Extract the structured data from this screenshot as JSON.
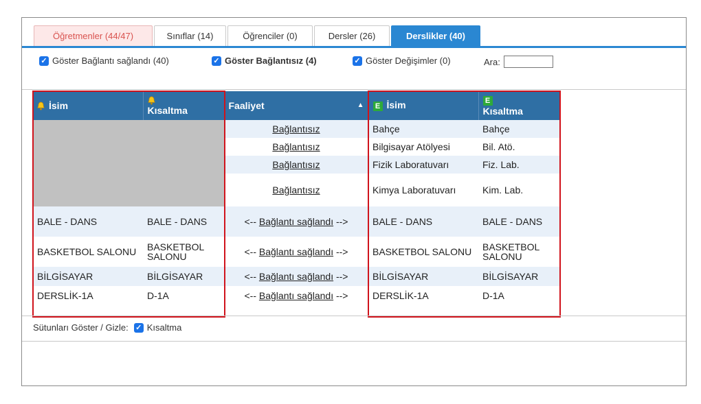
{
  "tabs": [
    {
      "label": "Öğretmenler (44/47)",
      "state": "warning"
    },
    {
      "label": "Sınıflar (14)",
      "state": "normal"
    },
    {
      "label": "Öğrenciler (0)",
      "state": "normal"
    },
    {
      "label": "Dersler (26)",
      "state": "normal"
    },
    {
      "label": "Derslikler (40)",
      "state": "active"
    }
  ],
  "filters": {
    "connected_label": "Göster Bağlantı sağlandı (40)",
    "unconnected_label": "Göster Bağlantısız (4)",
    "changes_label": "Göster Değişimler (0)",
    "search_label": "Ara:",
    "search_value": ""
  },
  "table": {
    "headers": {
      "left_name": "İsim",
      "left_abbr": "Kısaltma",
      "activity": "Faaliyet",
      "right_name": "İsim",
      "right_abbr": "Kısaltma"
    },
    "sort_indicator": "▲",
    "rows": [
      {
        "left_name": "",
        "left_abbr": "",
        "activity": "Bağlantısız",
        "right_name": "Bahçe",
        "right_abbr": "Bahçe"
      },
      {
        "left_name": "",
        "left_abbr": "",
        "activity": "Bağlantısız",
        "right_name": "Bilgisayar Atölyesi",
        "right_abbr": "Bil. Atö."
      },
      {
        "left_name": "",
        "left_abbr": "",
        "activity": "Bağlantısız",
        "right_name": "Fizik Laboratuvarı",
        "right_abbr": "Fiz. Lab."
      },
      {
        "left_name": "",
        "left_abbr": "",
        "activity": "Bağlantısız",
        "right_name": "Kimya Laboratuvarı",
        "right_abbr": "Kim. Lab."
      },
      {
        "left_name": "BALE - DANS",
        "left_abbr": "BALE - DANS",
        "activity_prefix": "<-- ",
        "activity": "Bağlantı sağlandı",
        "activity_suffix": " -->",
        "right_name": "BALE - DANS",
        "right_abbr": "BALE - DANS"
      },
      {
        "left_name": "BASKETBOL SALONU",
        "left_abbr": "BASKETBOL SALONU",
        "activity_prefix": "<-- ",
        "activity": "Bağlantı sağlandı",
        "activity_suffix": " -->",
        "right_name": "BASKETBOL SALONU",
        "right_abbr": "BASKETBOL SALONU"
      },
      {
        "left_name": "BİLGİSAYAR",
        "left_abbr": "BİLGİSAYAR",
        "activity_prefix": "<-- ",
        "activity": "Bağlantı sağlandı",
        "activity_suffix": " -->",
        "right_name": "BİLGİSAYAR",
        "right_abbr": "BİLGİSAYAR"
      },
      {
        "left_name": "DERSLİK-1A",
        "left_abbr": "D-1A",
        "activity_prefix": "<-- ",
        "activity": "Bağlantı sağlandı",
        "activity_suffix": " -->",
        "right_name": "DERSLİK-1A",
        "right_abbr": "D-1A"
      }
    ]
  },
  "columns_toggle": {
    "label": "Sütunları Göster / Gizle:",
    "option_label": "Kısaltma"
  },
  "icons": {
    "left_header_icon": "bell-icon",
    "right_header_icon": "e-icon",
    "checkbox": "check-icon"
  },
  "colors": {
    "accent": "#2a87d2",
    "header_bg": "#2f6fa4",
    "warning_tab_bg": "#fde8e8",
    "warning_tab_text": "#d9534f",
    "highlight_box": "#d0121b",
    "masked_cell": "#c1c1c1",
    "alt_row": "#e8f0f9",
    "checkbox": "#1b73e8",
    "e_icon": "#2eaa3a"
  }
}
